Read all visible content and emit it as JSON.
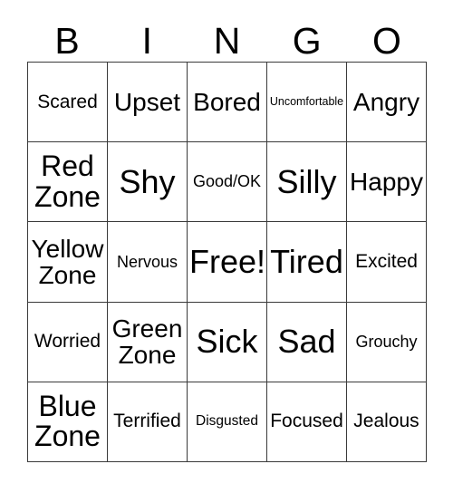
{
  "card": {
    "title_letters": [
      "B",
      "I",
      "N",
      "G",
      "O"
    ],
    "border_color": "#3a3a3a",
    "text_color": "#000000",
    "background_color": "#ffffff",
    "rows": [
      [
        {
          "label": "Scared",
          "size": "sz-l"
        },
        {
          "label": "Upset",
          "size": "sz-xxl"
        },
        {
          "label": "Bored",
          "size": "sz-xxl"
        },
        {
          "label": "Uncomfortable",
          "size": "sz-xs"
        },
        {
          "label": "Angry",
          "size": "sz-xxl"
        }
      ],
      [
        {
          "label": "Red\nZone",
          "size": "sz-xxxl"
        },
        {
          "label": "Shy",
          "size": "sz-huge"
        },
        {
          "label": "Good/OK",
          "size": "sz-m"
        },
        {
          "label": "Silly",
          "size": "sz-huge"
        },
        {
          "label": "Happy",
          "size": "sz-xxl"
        }
      ],
      [
        {
          "label": "Yellow\nZone",
          "size": "sz-xxl"
        },
        {
          "label": "Nervous",
          "size": "sz-m"
        },
        {
          "label": "Free!",
          "size": "sz-huge"
        },
        {
          "label": "Tired",
          "size": "sz-huge"
        },
        {
          "label": "Excited",
          "size": "sz-l"
        }
      ],
      [
        {
          "label": "Worried",
          "size": "sz-l"
        },
        {
          "label": "Green\nZone",
          "size": "sz-xxl"
        },
        {
          "label": "Sick",
          "size": "sz-huge"
        },
        {
          "label": "Sad",
          "size": "sz-huge"
        },
        {
          "label": "Grouchy",
          "size": "sz-m"
        }
      ],
      [
        {
          "label": "Blue\nZone",
          "size": "sz-xxxl"
        },
        {
          "label": "Terrified",
          "size": "sz-l"
        },
        {
          "label": "Disgusted",
          "size": "sz-s"
        },
        {
          "label": "Focused",
          "size": "sz-l"
        },
        {
          "label": "Jealous",
          "size": "sz-l"
        }
      ]
    ]
  }
}
